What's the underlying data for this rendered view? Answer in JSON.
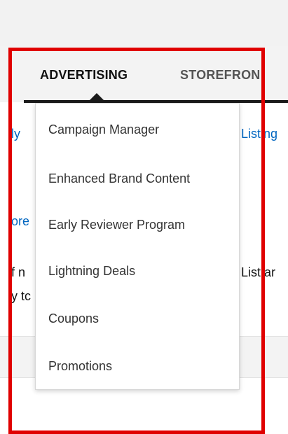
{
  "nav": {
    "tabs": [
      {
        "label": "ADVERTISING"
      },
      {
        "label": "STOREFRON"
      }
    ]
  },
  "background": {
    "frag_ly": "ly",
    "frag_listing": "Listing",
    "frag_ore": "ore",
    "frag_fn": "f n",
    "frag_list_ar": "List ar",
    "frag_ytc": "y tc"
  },
  "menu": {
    "items": [
      {
        "label": "Campaign Manager"
      },
      {
        "label": "Enhanced Brand Content"
      },
      {
        "label": "Early Reviewer Program"
      },
      {
        "label": "Lightning Deals"
      },
      {
        "label": "Coupons"
      },
      {
        "label": "Promotions"
      }
    ]
  },
  "colors": {
    "highlight": "#e00000",
    "link": "#0066c0"
  }
}
